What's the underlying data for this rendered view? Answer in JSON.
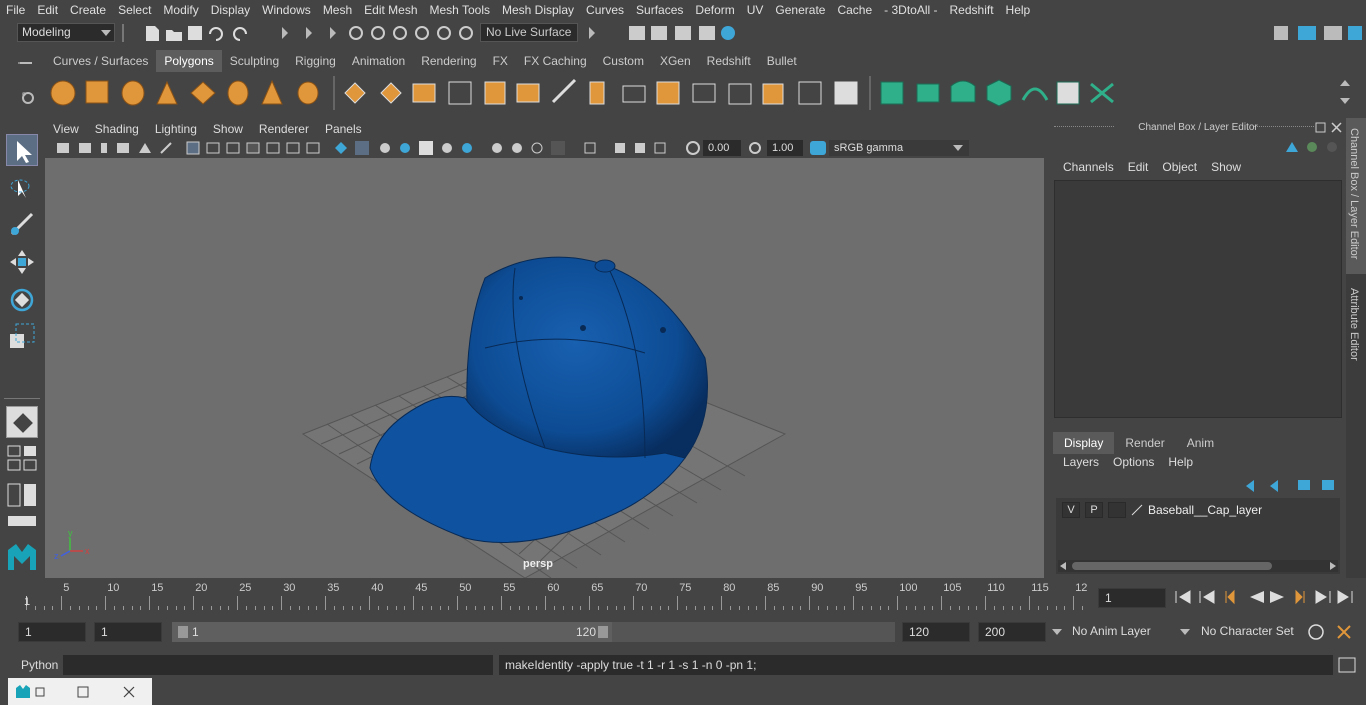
{
  "menu": [
    "File",
    "Edit",
    "Create",
    "Select",
    "Modify",
    "Display",
    "Windows",
    "Mesh",
    "Edit Mesh",
    "Mesh Tools",
    "Mesh Display",
    "Curves",
    "Surfaces",
    "Deform",
    "UV",
    "Generate",
    "Cache",
    "- 3DtoAll -",
    "Redshift",
    "Help"
  ],
  "statusline": {
    "mode": "Modeling",
    "live_surface": "No Live Surface"
  },
  "shelf_tabs": [
    "Curves / Surfaces",
    "Polygons",
    "Sculpting",
    "Rigging",
    "Animation",
    "Rendering",
    "FX",
    "FX Caching",
    "Custom",
    "XGen",
    "Redshift",
    "Bullet"
  ],
  "active_shelf_tab": "Polygons",
  "viewport_menu": [
    "View",
    "Shading",
    "Lighting",
    "Show",
    "Renderer",
    "Panels"
  ],
  "viewport_toolbar": {
    "exposure": "0.00",
    "gamma": "1.00",
    "colorspace": "sRGB gamma"
  },
  "viewport": {
    "camera_label": "persp",
    "object": "Baseball Cap",
    "cap_color": "#0d4c94",
    "axis": {
      "x_color": "#d04040",
      "y_color": "#40c040",
      "z_color": "#4060e0",
      "y": "y",
      "x": "x",
      "z": "z"
    }
  },
  "channel_box": {
    "title": "Channel Box / Layer Editor",
    "menu": [
      "Channels",
      "Edit",
      "Object",
      "Show"
    ]
  },
  "layer_editor": {
    "tabs": [
      "Display",
      "Render",
      "Anim"
    ],
    "active_tab": "Display",
    "menu": [
      "Layers",
      "Options",
      "Help"
    ],
    "layers": [
      {
        "v": "V",
        "p": "P",
        "name": "Baseball__Cap_layer"
      }
    ]
  },
  "side_tabs": [
    "Channel Box / Layer Editor",
    "Attribute Editor"
  ],
  "timeline": {
    "ticks": [
      "5",
      "10",
      "15",
      "20",
      "25",
      "30",
      "35",
      "40",
      "45",
      "50",
      "55",
      "60",
      "65",
      "70",
      "75",
      "80",
      "85",
      "90",
      "95",
      "100",
      "105",
      "110",
      "115",
      "12"
    ],
    "start_marker": "1",
    "current_frame": "1"
  },
  "range": {
    "start": "1",
    "playback_start": "1",
    "slider_start": "1",
    "slider_end": "120",
    "end": "120",
    "anim_end": "200",
    "anim_layer": "No Anim Layer",
    "character_set": "No Character Set"
  },
  "command": {
    "language": "Python",
    "output": "makeIdentity -apply true -t 1 -r 1 -s 1 -n 0 -pn 1;"
  }
}
